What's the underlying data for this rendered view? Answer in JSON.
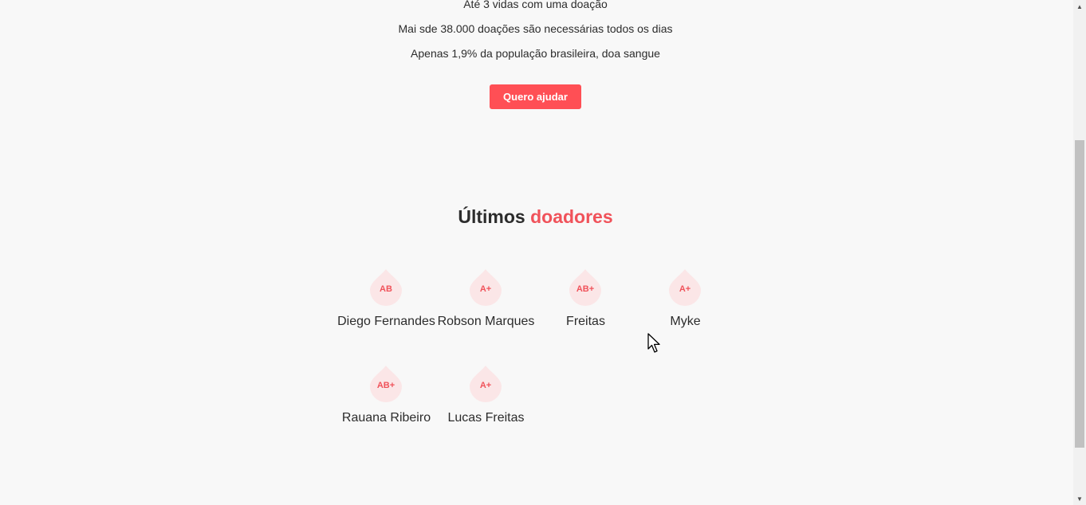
{
  "stats": {
    "line1": "Até 3 vidas com uma doação",
    "line2": "Mai sde 38.000 doações são necessárias todos os dias",
    "line3": "Apenas 1,9% da população brasileira, doa sangue"
  },
  "cta": {
    "label": "Quero ajudar"
  },
  "section": {
    "title_plain": "Últimos",
    "title_accent": "doadores"
  },
  "donors": [
    {
      "name": "Diego Fernandes",
      "blood_type": "AB"
    },
    {
      "name": "Robson Marques",
      "blood_type": "A+"
    },
    {
      "name": "Freitas",
      "blood_type": "AB+"
    },
    {
      "name": "Myke",
      "blood_type": "A+"
    },
    {
      "name": "Rauana Ribeiro",
      "blood_type": "AB+"
    },
    {
      "name": "Lucas Freitas",
      "blood_type": "A+"
    }
  ],
  "colors": {
    "accent": "#f0525a",
    "button": "#ff4f55",
    "drop_fill": "#fbe6e7",
    "background": "#f8f8f8"
  },
  "icons": {
    "drop": "blood-drop-icon",
    "cursor": "mouse-pointer-icon"
  }
}
